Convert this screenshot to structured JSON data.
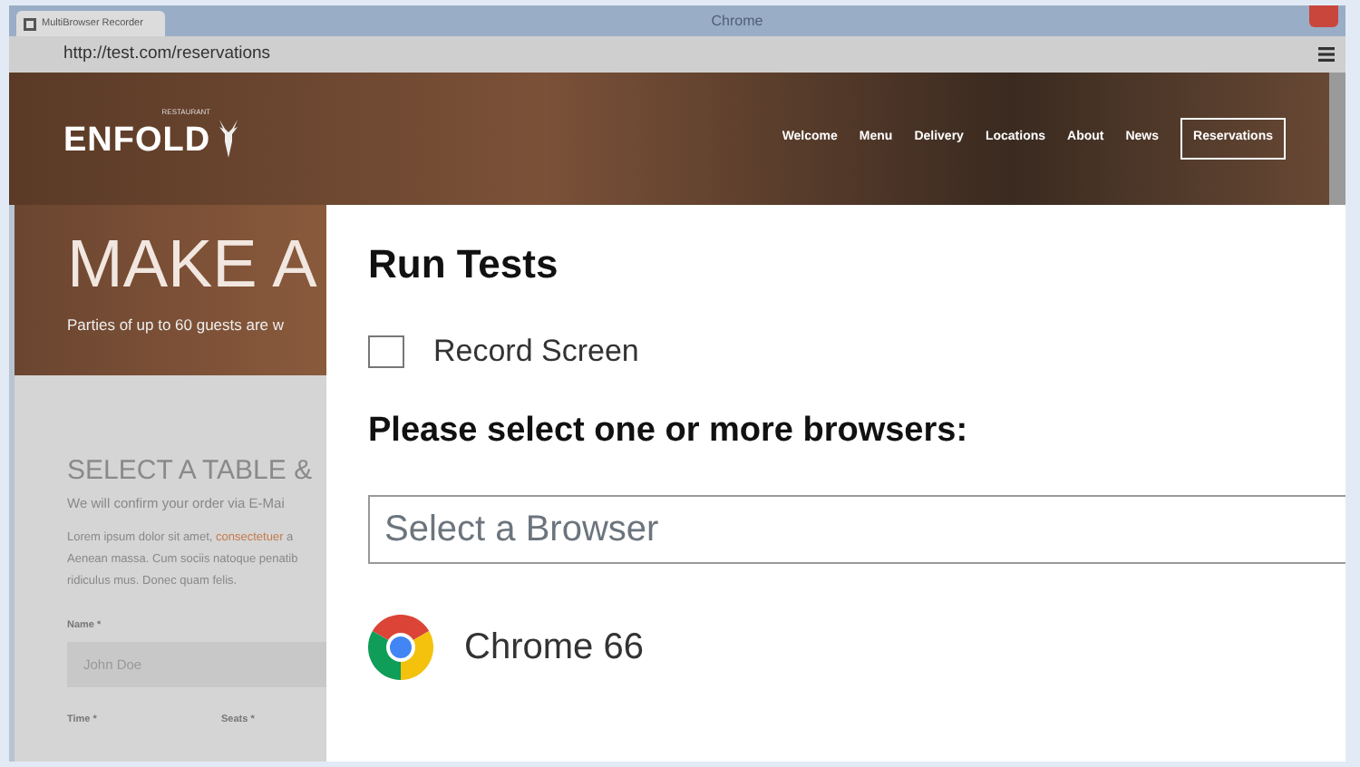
{
  "window": {
    "tab_title": "MultiBrowser Recorder",
    "title": "Chrome",
    "url": "http://test.com/reservations"
  },
  "site": {
    "logo": "ENFOLD",
    "logo_tag": "RESTAURANT",
    "nav": [
      {
        "label": "Welcome",
        "selected": false
      },
      {
        "label": "Menu",
        "selected": false
      },
      {
        "label": "Delivery",
        "selected": false
      },
      {
        "label": "Locations",
        "selected": false
      },
      {
        "label": "About",
        "selected": false
      },
      {
        "label": "News",
        "selected": false
      },
      {
        "label": "Reservations",
        "selected": true
      }
    ],
    "hero_title": "MAKE A",
    "hero_subtitle": "Parties of up to 60 guests are w",
    "section_title": "SELECT A TABLE &",
    "section_subtitle": "We will confirm your order via E-Mai",
    "paragraph": {
      "line_1_start": "Lorem ipsum dolor sit amet,",
      "link": "consectetuer",
      "line_1_end": "a",
      "lines": [
        "Aenean massa. Cum sociis natoque penatib",
        "ridiculus mus. Donec quam felis."
      ]
    },
    "form": {
      "name_label": "Name *",
      "name_value": "John Doe",
      "time_label": "Time *",
      "seats_label": "Seats *"
    }
  },
  "dialog": {
    "title": "Run Tests",
    "checkbox": {
      "label": "Record Screen",
      "checked": false
    },
    "prompt": "Please select one or more browsers:",
    "select": {
      "placeholder": "Select a Browser"
    },
    "browsers": [
      {
        "name": "Chrome 66",
        "kind": "chrome"
      }
    ]
  }
}
